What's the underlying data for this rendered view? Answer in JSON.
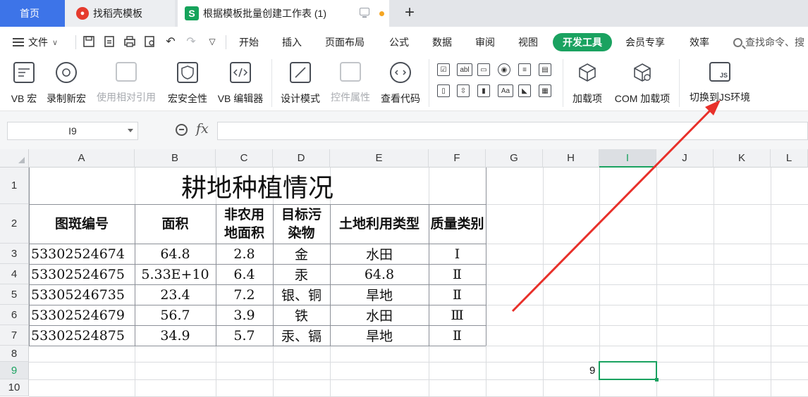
{
  "tabs": {
    "home": "首页",
    "template": "找稻壳模板",
    "active": "根据模板批量创建工作表 (1)",
    "active_badge": "S",
    "straw_badge": "●"
  },
  "menu": {
    "file": "文件",
    "items": [
      "开始",
      "插入",
      "页面布局",
      "公式",
      "数据",
      "审阅",
      "视图"
    ],
    "active": "开发工具",
    "items2": [
      "会员专享",
      "效率"
    ],
    "search": "查找命令、搜"
  },
  "ribbon": {
    "buttons": [
      {
        "label": "VB 宏",
        "icon": "vb-macro-icon",
        "enabled": true
      },
      {
        "label": "录制新宏",
        "icon": "record-macro-icon",
        "enabled": true
      },
      {
        "label": "使用相对引用",
        "icon": "relative-reference-icon",
        "enabled": false
      },
      {
        "label": "宏安全性",
        "icon": "macro-security-icon",
        "enabled": true
      },
      {
        "label": "VB 编辑器",
        "icon": "vb-editor-icon",
        "enabled": true
      },
      {
        "label": "设计模式",
        "icon": "design-mode-icon",
        "enabled": true
      },
      {
        "label": "控件属性",
        "icon": "control-properties-icon",
        "enabled": false
      },
      {
        "label": "查看代码",
        "icon": "view-code-icon",
        "enabled": true
      },
      {
        "label": "加载项",
        "icon": "addins-icon",
        "enabled": true
      },
      {
        "label": "COM 加载项",
        "icon": "com-addins-icon",
        "enabled": true
      },
      {
        "label": "切换到JS环境",
        "icon": "switch-js-icon",
        "enabled": true
      }
    ],
    "small_glyphs": [
      "☑",
      "abl",
      "▭",
      "◉",
      "≡",
      "▤",
      "▯",
      "⇳",
      "▮",
      "Aa",
      "◣",
      "▦"
    ]
  },
  "formula": {
    "cell_ref": "I9",
    "fx": "fx",
    "value": ""
  },
  "columns": [
    "A",
    "B",
    "C",
    "D",
    "E",
    "F",
    "G",
    "H",
    "I",
    "J",
    "K",
    "L"
  ],
  "selected_column": "I",
  "rows": [
    "1",
    "2",
    "3",
    "4",
    "5",
    "6",
    "7",
    "8",
    "9",
    "10"
  ],
  "selected_row": "9",
  "sheet": {
    "title": "耕地种植情况",
    "headers": [
      "图斑编号",
      "面积",
      "非农用地面积",
      "目标污染物",
      "土地利用类型",
      "质量类别"
    ],
    "data": [
      [
        "53302524674",
        "64.8",
        "2.8",
        "金",
        "水田",
        "Ⅰ"
      ],
      [
        "53302524675",
        "5.33E+10",
        "6.4",
        "汞",
        "64.8",
        "Ⅱ"
      ],
      [
        "53305246735",
        "23.4",
        "7.2",
        "银、铜",
        "旱地",
        "Ⅱ"
      ],
      [
        "53302524679",
        "56.7",
        "3.9",
        "铁",
        "水田",
        "Ⅲ"
      ],
      [
        "53302524875",
        "34.9",
        "5.7",
        "汞、镉",
        "旱地",
        "Ⅱ"
      ]
    ],
    "h9": "9"
  },
  "colors": {
    "accent": "#1aa260",
    "home_tab": "#3d74e8",
    "annotation_arrow": "#e8302a"
  }
}
